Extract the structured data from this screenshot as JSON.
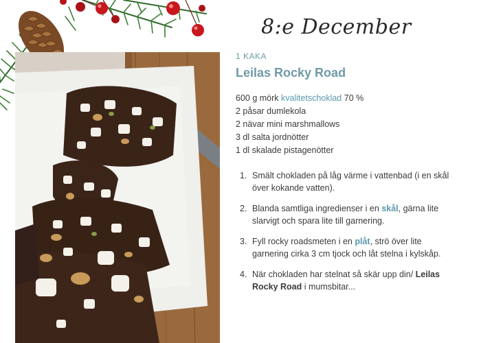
{
  "header": {
    "date_title": "8:e December"
  },
  "recipe": {
    "kicker": "1 KAKA",
    "title": "Leilas Rocky Road",
    "ingredients": [
      {
        "pre": "600 g mörk ",
        "link": "kvalitetschoklad",
        "post": " 70 %"
      },
      {
        "pre": "2 påsar dumlekola"
      },
      {
        "pre": "2 nävar mini marshmallows"
      },
      {
        "pre": "3 dl salta jordnötter"
      },
      {
        "pre": "1 dl skalade pistagenötter"
      }
    ],
    "steps": [
      {
        "num": "1.",
        "a": "Smält chokladen på låg värme i vattenbad (i en skål över kokande vatten)."
      },
      {
        "num": "2.",
        "a": "Blanda samtliga ingredienser i en ",
        "b": "skål",
        "c": ", gärna lite slarvigt och spara lite till garnering."
      },
      {
        "num": "3.",
        "a": "Fyll rocky roadsmeten i en ",
        "b": "plåt",
        "c": ", strö över lite garnering cirka 3 cm tjock och låt stelna i kylskåp."
      },
      {
        "num": "4.",
        "a": "När chokladen har stelnat så skär upp din/ ",
        "b": "Leilas Rocky Road",
        "c": " i mumsbitar..."
      }
    ]
  }
}
